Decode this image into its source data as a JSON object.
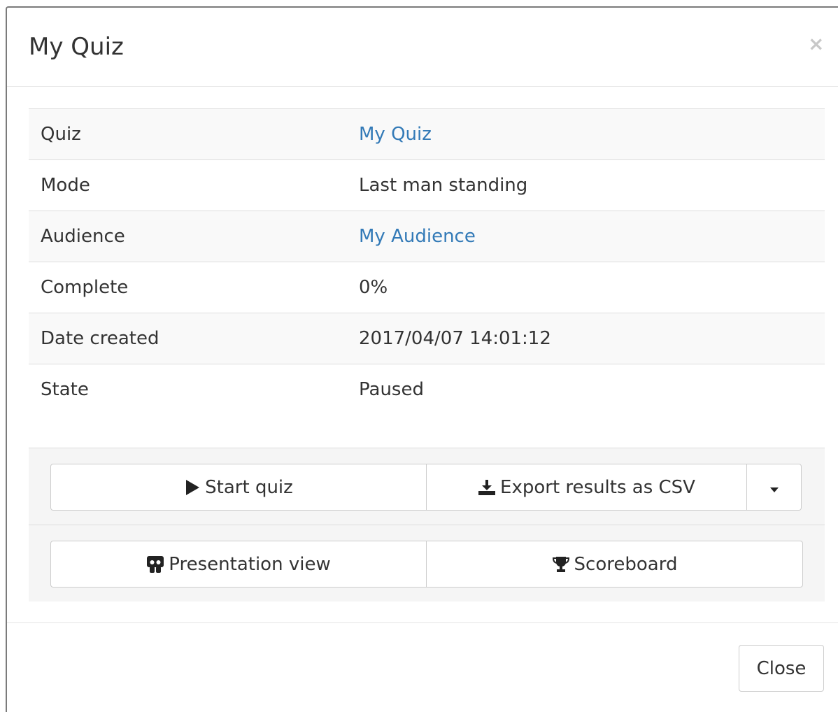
{
  "modal": {
    "title": "My Quiz",
    "close_x": "×"
  },
  "details": [
    {
      "label": "Quiz",
      "value": "My Quiz",
      "link": true
    },
    {
      "label": "Mode",
      "value": "Last man standing",
      "link": false
    },
    {
      "label": "Audience",
      "value": "My Audience",
      "link": true
    },
    {
      "label": "Complete",
      "value": "0%",
      "link": false
    },
    {
      "label": "Date created",
      "value": "2017/04/07 14:01:12",
      "link": false
    },
    {
      "label": "State",
      "value": "Paused",
      "link": false
    }
  ],
  "actions": {
    "start_quiz": "Start quiz",
    "export_csv": "Export results as CSV",
    "presentation_view": "Presentation view",
    "scoreboard": "Scoreboard"
  },
  "footer": {
    "close": "Close"
  },
  "icons": {
    "start": "play-icon",
    "export": "download-icon",
    "dropdown": "caret-down-icon",
    "presentation": "slideshare-icon",
    "scoreboard": "trophy-icon"
  },
  "colors": {
    "link": "#337ab7",
    "border": "#cccccc",
    "panel": "#f5f5f5"
  }
}
